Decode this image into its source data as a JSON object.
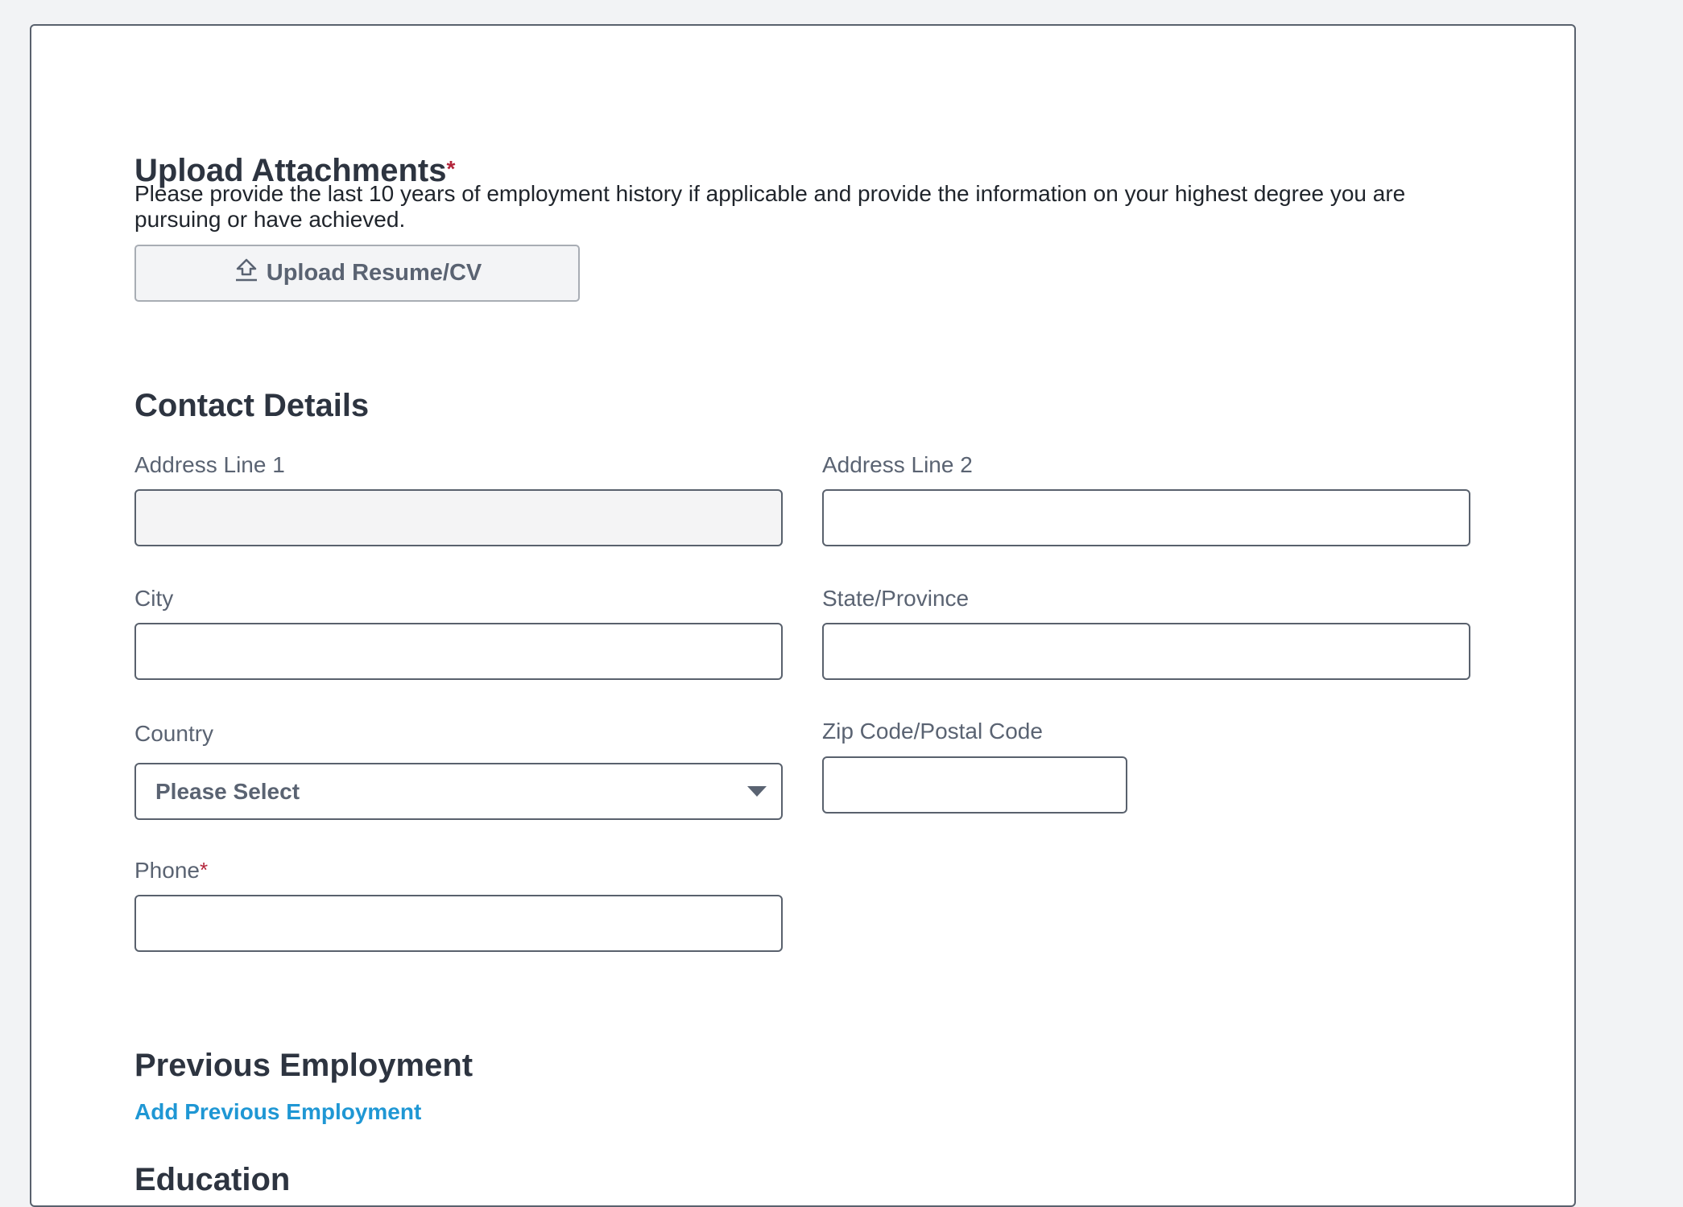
{
  "upload_section": {
    "title": "Upload Attachments",
    "required_mark": "*",
    "description": "Please provide the last 10 years of employment history if applicable and provide the information on your highest degree you are pursuing or have achieved.",
    "upload_button_label": "Upload Resume/CV",
    "upload_icon": "upload-icon"
  },
  "contact_section": {
    "title": "Contact Details",
    "address_line_1": {
      "label": "Address Line 1",
      "value": ""
    },
    "address_line_2": {
      "label": "Address Line 2",
      "value": ""
    },
    "city": {
      "label": "City",
      "value": ""
    },
    "state": {
      "label": "State/Province",
      "value": ""
    },
    "country": {
      "label": "Country",
      "selected": "Please Select"
    },
    "zip": {
      "label": "Zip Code/Postal Code",
      "value": ""
    },
    "phone": {
      "label": "Phone",
      "required_mark": "*",
      "value": ""
    }
  },
  "employment_section": {
    "title": "Previous Employment",
    "add_link": "Add Previous Employment"
  },
  "education_section": {
    "title": "Education"
  },
  "colors": {
    "background": "#f2f3f5",
    "card": "#ffffff",
    "border": "#59616d",
    "required": "#b3243a",
    "link": "#1f97d4",
    "label": "#5a6372"
  }
}
